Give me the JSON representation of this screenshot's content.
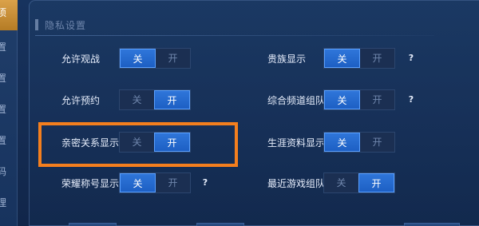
{
  "sidebar": {
    "tabs": [
      {
        "label": "项",
        "active": true
      },
      {
        "label": "置",
        "active": false
      },
      {
        "label": "置",
        "active": false
      },
      {
        "label": "置",
        "active": false
      },
      {
        "label": "置",
        "active": false
      },
      {
        "label": "码",
        "active": false
      },
      {
        "label": "理",
        "active": false
      }
    ]
  },
  "section": {
    "title": "隐私设置"
  },
  "toggle_options": {
    "off": "关",
    "on": "开"
  },
  "settings": {
    "allow_spectate": {
      "label": "允许观战",
      "state": "关"
    },
    "allow_reservation": {
      "label": "允许预约",
      "state": "开"
    },
    "intimacy_display": {
      "label": "亲密关系显示",
      "state": "开"
    },
    "honor_title_display": {
      "label": "荣耀称号显示",
      "state": "关",
      "help": "?"
    },
    "noble_display": {
      "label": "贵族显示",
      "state": "关",
      "help": "?"
    },
    "channel_team": {
      "label": "综合频道组队",
      "state": "关",
      "help": "?"
    },
    "career_display": {
      "label": "生涯资料显示",
      "state": "关"
    },
    "recent_game_team": {
      "label": "最近游戏组队",
      "state": "开"
    }
  },
  "colors": {
    "background": "#17335e",
    "toggle_active": "#2f76da",
    "highlight_border": "#f47f1e",
    "sidebar_active": "#dba24a"
  }
}
